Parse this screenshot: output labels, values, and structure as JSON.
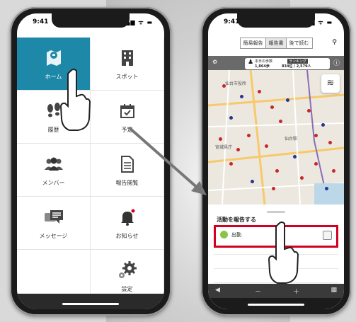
{
  "left_phone": {
    "status": {
      "time": "9:41",
      "icons": "▂▄▆ ᯤ ▬"
    },
    "menu": [
      {
        "label": "ホーム",
        "icon": "map-pin-icon",
        "active": true
      },
      {
        "label": "スポット",
        "icon": "building-icon",
        "active": false
      },
      {
        "label": "履歴",
        "icon": "footprints-icon",
        "active": false
      },
      {
        "label": "予定",
        "icon": "calendar-check-icon",
        "active": false
      },
      {
        "label": "メンバー",
        "icon": "group-icon",
        "active": false
      },
      {
        "label": "報告閲覧",
        "icon": "document-icon",
        "active": false
      },
      {
        "label": "メッセージ",
        "icon": "chat-icon",
        "active": false
      },
      {
        "label": "お知らせ",
        "icon": "bell-icon",
        "active": false
      },
      {
        "label": "",
        "icon": "",
        "active": false
      },
      {
        "label": "設定",
        "icon": "gear-icon",
        "active": false
      }
    ]
  },
  "right_phone": {
    "status": {
      "time": "9:41",
      "icons": "▂▄▆ ᯤ ▬"
    },
    "tabs": [
      "簡易報告",
      "報告書",
      "後で読む"
    ],
    "active_tab": "報告書",
    "info": {
      "today_label": "本日の歩数",
      "steps": "1,864歩",
      "rank_label": "ランキング",
      "rank": "834位 / 2,579人"
    },
    "map_labels": [
      "仙台市役所",
      "仙台駅",
      "宮城県庁"
    ],
    "sheet_title": "活動を報告する",
    "report_item": "出勤",
    "toolbar": {
      "back": "◀",
      "minus": "－",
      "plus": "＋",
      "grid": "▦"
    }
  },
  "colors": {
    "accent": "#1e88a8",
    "highlight": "#d4001f",
    "check": "#8bc34a"
  }
}
